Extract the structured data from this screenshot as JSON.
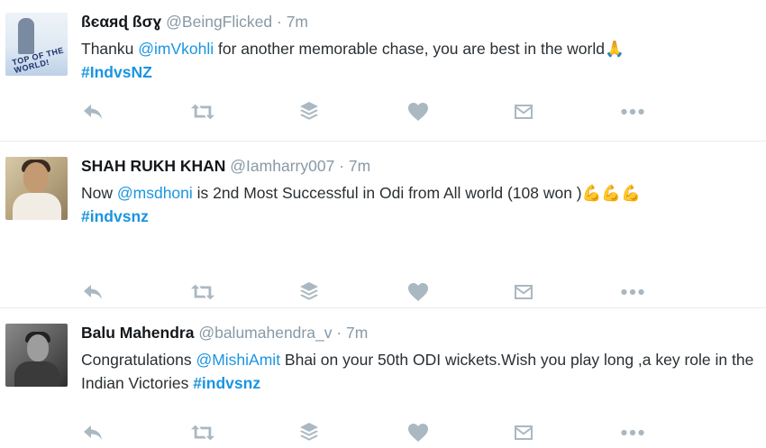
{
  "tweets": [
    {
      "name": "ßєαяɖ ßσɣ",
      "handle": "@BeingFlicked",
      "time": "7m",
      "segments": [
        {
          "type": "text",
          "value": "Thanku "
        },
        {
          "type": "mention",
          "value": "@imVkohli"
        },
        {
          "type": "text",
          "value": " for another memorable chase, you are best in the world"
        },
        {
          "type": "emoji",
          "value": "🙏"
        }
      ],
      "hashtag": "#IndvsNZ",
      "avatar_text": "TOP OF THE WORLD!"
    },
    {
      "name": "SHAH RUKH KHAN",
      "handle": "@Iamharry007",
      "time": "7m",
      "segments": [
        {
          "type": "text",
          "value": "Now "
        },
        {
          "type": "mention",
          "value": "@msdhoni"
        },
        {
          "type": "text",
          "value": "  is 2nd Most Successful in Odi from All world  (108 won )"
        },
        {
          "type": "emoji",
          "value": "💪💪💪"
        }
      ],
      "hashtag": "#indvsnz"
    },
    {
      "name": "Balu Mahendra",
      "handle": "@balumahendra_v",
      "time": "7m",
      "segments": [
        {
          "type": "text",
          "value": "Congratulations "
        },
        {
          "type": "mention",
          "value": "@MishiAmit"
        },
        {
          "type": "text",
          "value": " Bhai on your 50th ODI wickets.Wish you play long ,a key role in the  Indian Victories "
        }
      ],
      "hashtag": "#indvsnz"
    }
  ],
  "actions": [
    "reply-icon",
    "retweet-icon",
    "stack-icon",
    "like-icon",
    "direct-message-icon",
    "more-icon"
  ],
  "colors": {
    "link": "#1b95e0",
    "muted": "#8899a6",
    "icon": "#aab8c2",
    "divider": "#e6ecf0"
  }
}
